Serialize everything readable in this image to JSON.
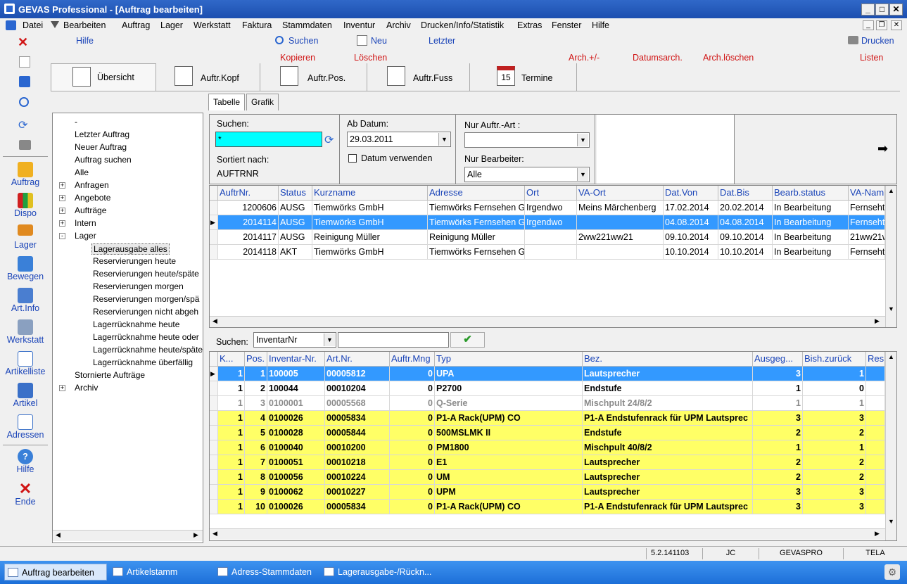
{
  "window": {
    "title": "GEVAS Professional - [Auftrag bearbeiten]"
  },
  "menu": [
    "Datei",
    "Bearbeiten",
    "Auftrag",
    "Lager",
    "Werkstatt",
    "Faktura",
    "Stammdaten",
    "Inventur",
    "Archiv",
    "Drucken/Info/Statistik",
    "Extras",
    "Fenster",
    "Hilfe"
  ],
  "toolbar": {
    "hilfe": "Hilfe",
    "suchen": "Suchen",
    "neu": "Neu",
    "letzter": "Letzter",
    "drucken": "Drucken",
    "kopieren": "Kopieren",
    "loeschen": "Löschen",
    "arch_plus": "Arch.+/-",
    "datumsarch": "Datumsarch.",
    "arch_loeschen": "Arch.löschen",
    "listen": "Listen"
  },
  "sidebar": [
    "Auftrag",
    "Dispo",
    "Lager",
    "Bewegen",
    "Art.Info",
    "Werkstatt",
    "Artikelliste",
    "Artikel",
    "Adressen",
    "Hilfe",
    "Ende"
  ],
  "tabs": [
    "Übersicht",
    "Auftr.Kopf",
    "Auftr.Pos.",
    "Auftr.Fuss",
    "Termine"
  ],
  "tree": [
    {
      "label": "-",
      "indent": 0,
      "expander": false
    },
    {
      "label": "Letzter Auftrag",
      "indent": 0,
      "expander": false
    },
    {
      "label": "Neuer Auftrag",
      "indent": 0,
      "expander": false
    },
    {
      "label": "Auftrag suchen",
      "indent": 0,
      "expander": false
    },
    {
      "label": "Alle",
      "indent": 0,
      "expander": false
    },
    {
      "label": "Anfragen",
      "indent": 0,
      "expander": "+"
    },
    {
      "label": "Angebote",
      "indent": 0,
      "expander": "+"
    },
    {
      "label": "Aufträge",
      "indent": 0,
      "expander": "+"
    },
    {
      "label": "Intern",
      "indent": 0,
      "expander": "+"
    },
    {
      "label": "Lager",
      "indent": 0,
      "expander": "-"
    },
    {
      "label": "Lagerausgabe alles",
      "indent": 1,
      "expander": false,
      "selected": true
    },
    {
      "label": "Reservierungen heute",
      "indent": 1,
      "expander": false
    },
    {
      "label": "Reservierungen heute/späte",
      "indent": 1,
      "expander": false
    },
    {
      "label": "Reservierungen morgen",
      "indent": 1,
      "expander": false
    },
    {
      "label": "Reservierungen morgen/spä",
      "indent": 1,
      "expander": false
    },
    {
      "label": "Reservierungen nicht abgeh",
      "indent": 1,
      "expander": false
    },
    {
      "label": "Lagerrücknahme heute",
      "indent": 1,
      "expander": false
    },
    {
      "label": "Lagerrücknahme heute oder",
      "indent": 1,
      "expander": false
    },
    {
      "label": "Lagerrücknahme heute/späte",
      "indent": 1,
      "expander": false
    },
    {
      "label": "Lagerrücknahme überfällig",
      "indent": 1,
      "expander": false
    },
    {
      "label": "Stornierte Aufträge",
      "indent": 0,
      "expander": false
    },
    {
      "label": "Archiv",
      "indent": 0,
      "expander": "+"
    }
  ],
  "subtabs": [
    "Tabelle",
    "Grafik"
  ],
  "filter": {
    "suchen_label": "Suchen:",
    "suchen_value": "*",
    "sortiert_label": "Sortiert nach:",
    "sortiert_value": "AUFTRNR",
    "ab_datum_label": "Ab Datum:",
    "ab_datum_value": "29.03.2011",
    "datum_verwenden": "Datum verwenden",
    "auftr_art_label": "Nur Auftr.-Art :",
    "auftr_art_value": "",
    "bearbeiter_label": "Nur Bearbeiter:",
    "bearbeiter_value": "Alle"
  },
  "orders": {
    "columns": [
      "AuftrNr.",
      "Status",
      "Kurzname",
      "Adresse",
      "Ort",
      "VA-Ort",
      "Dat.Von",
      "Dat.Bis",
      "Bearb.status",
      "VA-Nam"
    ],
    "rows": [
      [
        "1200606",
        "AUSG",
        "Tiemwörks GmbH",
        "Tiemwörks Fernsehen G",
        "Irgendwo",
        "Meins Märchenberg",
        "17.02.2014",
        "20.02.2014",
        "In Bearbeitung",
        "Fernseht"
      ],
      [
        "2014114",
        "AUSG",
        "Tiemwörks GmbH",
        "Tiemwörks Fernsehen G",
        "Irgendwo",
        "",
        "04.08.2014",
        "04.08.2014",
        "In Bearbeitung",
        "Fernseht"
      ],
      [
        "2014117",
        "AUSG",
        "Reinigung Müller",
        "Reinigung Müller",
        "",
        "2ww221ww21",
        "09.10.2014",
        "09.10.2014",
        "In Bearbeitung",
        "21ww21w"
      ],
      [
        "2014118",
        "AKT",
        "Tiemwörks GmbH",
        "Tiemwörks Fernsehen G",
        "",
        "",
        "10.10.2014",
        "10.10.2014",
        "In Bearbeitung",
        "Fernseht"
      ]
    ]
  },
  "pos_search": {
    "label": "Suchen:",
    "field": "InventarNr",
    "value": ""
  },
  "positions": {
    "columns": [
      "K...",
      "Pos.",
      "Inventar-Nr.",
      "Art.Nr.",
      "Auftr.Mng",
      "Typ",
      "Bez.",
      "Ausgeg...",
      "Bish.zurück",
      "Res"
    ],
    "rows": [
      [
        "1",
        "1",
        "100005",
        "00005812",
        "0",
        "UPA",
        "Lautsprecher",
        "3",
        "1",
        ""
      ],
      [
        "1",
        "2",
        "100044",
        "00010204",
        "0",
        "P2700",
        "Endstufe",
        "1",
        "0",
        ""
      ],
      [
        "1",
        "3",
        "0100001",
        "00005568",
        "0",
        "Q-Serie",
        "Mischpult 24/8/2",
        "1",
        "1",
        ""
      ],
      [
        "1",
        "4",
        "0100026",
        "00005834",
        "0",
        "P1-A Rack(UPM) CO",
        "P1-A Endstufenrack für UPM Lautsprec",
        "3",
        "3",
        ""
      ],
      [
        "1",
        "5",
        "0100028",
        "00005844",
        "0",
        "500MSLMK II",
        "Endstufe",
        "2",
        "2",
        ""
      ],
      [
        "1",
        "6",
        "0100040",
        "00010200",
        "0",
        "PM1800",
        "Mischpult 40/8/2",
        "1",
        "1",
        ""
      ],
      [
        "1",
        "7",
        "0100051",
        "00010218",
        "0",
        "E1",
        "Lautsprecher",
        "2",
        "2",
        ""
      ],
      [
        "1",
        "8",
        "0100056",
        "00010224",
        "0",
        "UM",
        "Lautsprecher",
        "2",
        "2",
        ""
      ],
      [
        "1",
        "9",
        "0100062",
        "00010227",
        "0",
        "UPM",
        "Lautsprecher",
        "3",
        "3",
        ""
      ],
      [
        "1",
        "10",
        "0100026",
        "00005834",
        "0",
        "P1-A Rack(UPM) CO",
        "P1-A Endstufenrack für UPM Lautsprec",
        "3",
        "3",
        ""
      ]
    ],
    "row_styles": [
      "selected",
      "white",
      "grey",
      "yellow",
      "yellow",
      "yellow",
      "yellow",
      "yellow",
      "yellow",
      "yellow"
    ]
  },
  "status": [
    "5.2.141103",
    "JC",
    "GEVASPRO",
    "TELA"
  ],
  "taskbar": [
    "Auftrag bearbeiten",
    "Artikelstamm",
    "Adress-Stammdaten",
    "Lagerausgabe-/Rückn..."
  ],
  "colors": {
    "selection": "#3399ff",
    "highlight_row": "#ffff66",
    "search_field": "#00ffff",
    "link_blue": "#1a44b8",
    "action_red": "#d01414"
  }
}
